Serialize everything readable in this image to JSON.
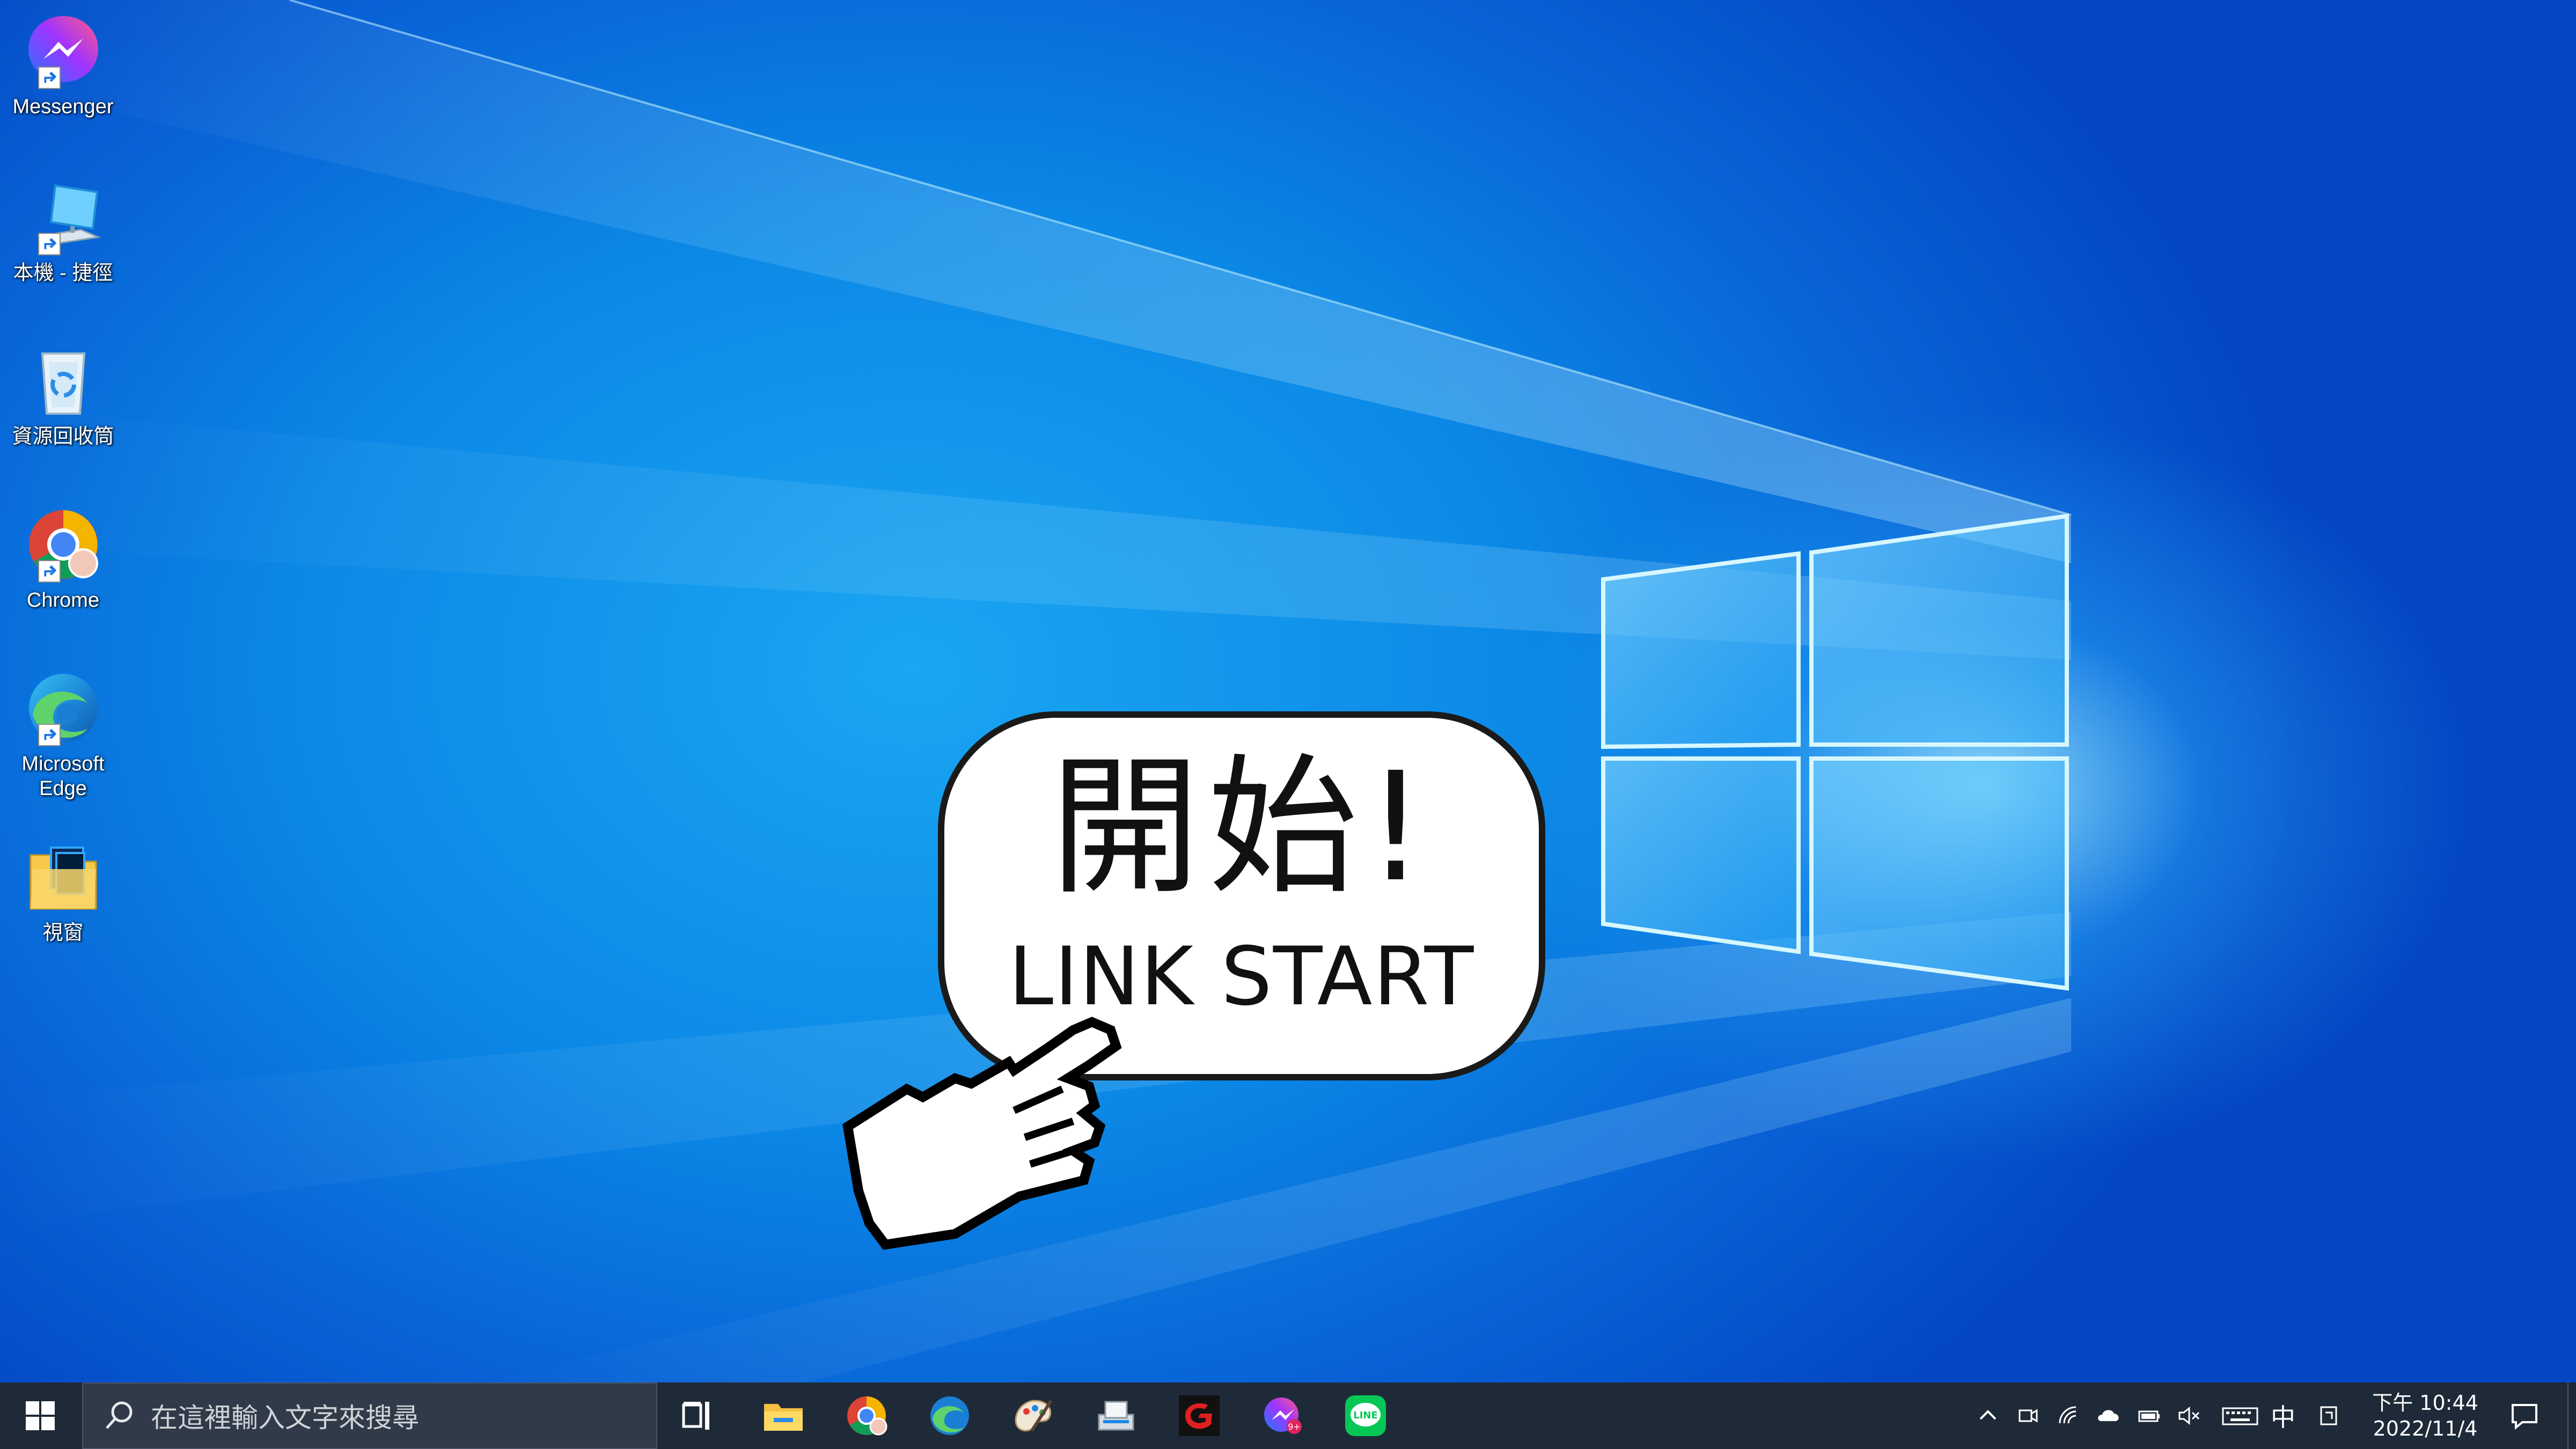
{
  "desktop": {
    "icons": [
      {
        "label": "Messenger",
        "icon": "messenger-icon"
      },
      {
        "label": "本機 - 捷徑",
        "icon": "this-pc-icon"
      },
      {
        "label": "資源回收筒",
        "icon": "recycle-bin-icon"
      },
      {
        "label": "Chrome",
        "icon": "chrome-icon"
      },
      {
        "label": "Microsoft Edge",
        "icon": "edge-icon"
      },
      {
        "label": "視窗",
        "icon": "folder-icon"
      }
    ]
  },
  "overlay": {
    "title": "開始!",
    "subtitle": "LINK START"
  },
  "taskbar": {
    "search_placeholder": "在這裡輸入文字來搜尋",
    "pinned_apps": [
      "task-view-icon",
      "file-explorer-icon",
      "chrome-icon",
      "edge-icon",
      "paint-icon",
      "scanner-icon",
      "garena-icon",
      "messenger-icon",
      "line-icon"
    ],
    "tray": {
      "ime_label": "中",
      "time": "下午 10:44",
      "date": "2022/11/4"
    }
  },
  "colors": {
    "taskbar": "#1f2a38",
    "wallpaper_blue": "#0b88e6",
    "accent": "#0078d7"
  }
}
